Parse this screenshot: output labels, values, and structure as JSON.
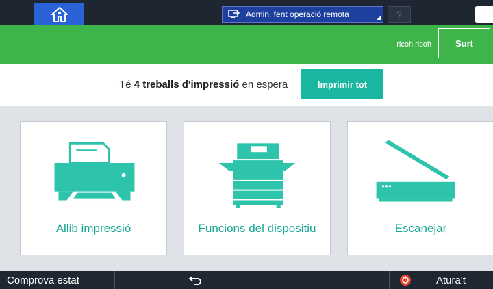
{
  "topbar": {
    "home_icon": "home-icon",
    "remote_label": "Admin. fent operació remota",
    "help_label": "?",
    "moon_icon": "moon-icon"
  },
  "header": {
    "user": "ricoh ricoh",
    "logout": "Surt"
  },
  "jobs": {
    "prefix": "Té",
    "count": "4",
    "middle": "treballs d'impressió",
    "suffix": "en espera",
    "print_all": "Imprimir tot"
  },
  "tiles": [
    {
      "label": "Allib impressió",
      "icon": "printer-icon"
    },
    {
      "label": "Funcions del dispositiu",
      "icon": "copier-icon"
    },
    {
      "label": "Escanejar",
      "icon": "scanner-icon"
    }
  ],
  "bottom": {
    "check_status": "Comprova estat",
    "back_icon": "back-icon",
    "stop_label": "Atura't"
  },
  "colors": {
    "green": "#3db54a",
    "teal": "#1ab7a0",
    "dark": "#1e2632",
    "stop_red": "#e8452e"
  }
}
